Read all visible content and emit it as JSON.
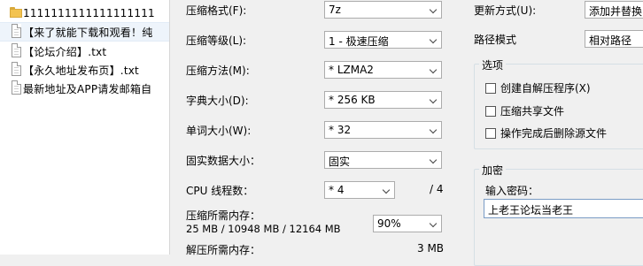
{
  "files": [
    {
      "name": "1111111111111111111",
      "icon": "folder-icon"
    },
    {
      "name": "【来了就能下载和观看！纯",
      "icon": "text-file-icon"
    },
    {
      "name": "【论坛介绍】.txt",
      "icon": "text-file-icon"
    },
    {
      "name": "【永久地址发布页】.txt",
      "icon": "text-file-icon"
    },
    {
      "name": "最新地址及APP请发邮箱自",
      "icon": "text-file-icon"
    }
  ],
  "options": {
    "format": {
      "label": "压缩格式(F):",
      "value": "7z"
    },
    "level": {
      "label": "压缩等级(L):",
      "value": "1 - 极速压缩"
    },
    "method": {
      "label": "压缩方法(M):",
      "value": "* LZMA2"
    },
    "dict": {
      "label": "字典大小(D):",
      "value": "* 256 KB"
    },
    "word": {
      "label": "单词大小(W):",
      "value": "* 32"
    },
    "solid": {
      "label": "固实数据大小：",
      "value": "固实"
    },
    "threads": {
      "label": "CPU 线程数：",
      "value": "* 4",
      "max": "/ 4"
    },
    "memory": {
      "label": "压缩所需内存：",
      "detail": "25 MB / 10948 MB / 12164 MB",
      "value": "90%"
    },
    "decomp": {
      "label": "解压所需内存：",
      "value": "3 MB"
    }
  },
  "right": {
    "update": {
      "label": "更新方式(U):",
      "value": "添加并替换"
    },
    "path": {
      "label": "路径模式",
      "value": "相对路径"
    },
    "options_group": {
      "title": "选项",
      "sfx": "创建自解压程序(X)",
      "shared": "压缩共享文件",
      "delete": "操作完成后删除源文件"
    },
    "encryption": {
      "title": "加密",
      "password_label": "输入密码：",
      "password": "上老王论坛当老王"
    }
  }
}
